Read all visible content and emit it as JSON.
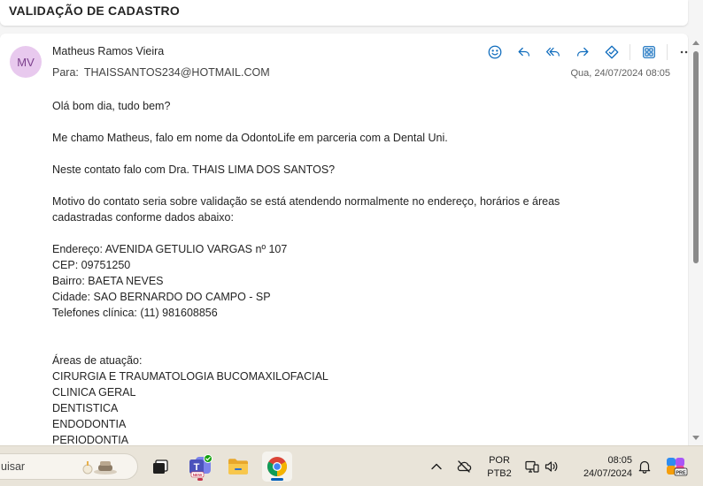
{
  "subject": "VALIDAÇÃO DE CADASTRO",
  "message": {
    "avatar_initials": "MV",
    "sender_name": "Matheus Ramos Vieira",
    "to_label": "Para:",
    "to_address": "THAISSANTOS234@HOTMAIL.COM",
    "date": "Qua, 24/07/2024 08:05",
    "actions": [
      "smiley-icon",
      "reply-icon",
      "reply-all-icon",
      "forward-icon",
      "markup-icon",
      "apps-icon",
      "more-icon"
    ],
    "body": {
      "greeting": "Olá bom dia, tudo bem?",
      "intro": "Me chamo Matheus, falo em nome da OdontoLife em parceria com a Dental Uni.",
      "question": "Neste contato falo com Dra. THAIS LIMA DOS SANTOS?",
      "reason_line1": "Motivo do contato seria sobre validação se está atendendo normalmente no endereço, horários e áreas",
      "reason_line2": "cadastradas conforme dados abaixo:",
      "address": "Endereço: AVENIDA GETULIO VARGAS nº 107",
      "cep": "CEP: 09751250",
      "neighborhood": "Bairro: BAETA NEVES",
      "city": "Cidade: SAO BERNARDO DO CAMPO - SP",
      "phone": "Telefones clínica: (11) 981608856",
      "areas_title": "Áreas de atuação:",
      "areas": [
        "CIRURGIA E TRAUMATOLOGIA BUCOMAXILOFACIAL",
        "CLINICA GERAL",
        "DENTISTICA",
        "ENDODONTIA",
        "PERIODONTIA"
      ]
    }
  },
  "taskbar": {
    "search_placeholder": "uisar",
    "language": "POR",
    "keyboard": "PTB2",
    "time": "08:05",
    "date": "24/07/2024",
    "teams_badge": "NEW",
    "copilot_badge": "PRE"
  },
  "colors": {
    "avatar_bg": "#e8c9ee",
    "avatar_text": "#7b3f8c",
    "action_icon": "#0f6cbd",
    "taskbar_bg": "#e9e4d9"
  }
}
